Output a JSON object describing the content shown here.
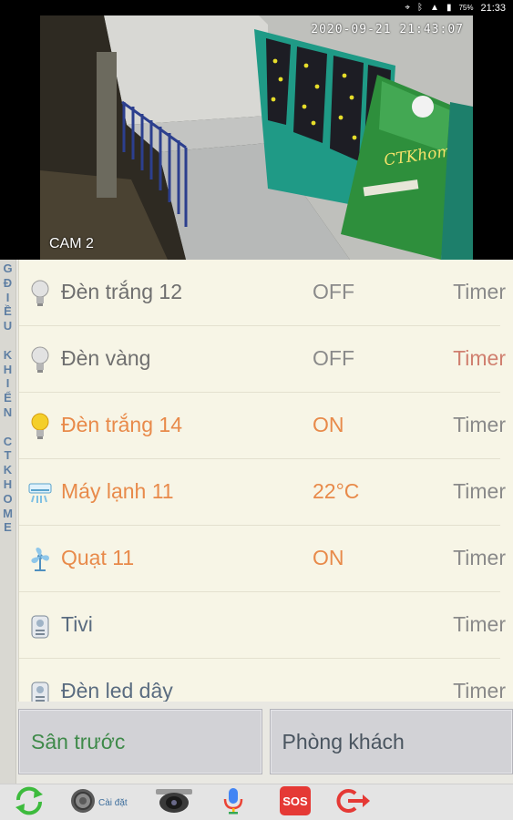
{
  "status_bar": {
    "battery": "75%",
    "time": "21:33"
  },
  "camera": {
    "timestamp": "2020-09-21 21:43:07",
    "label": "CAM 2",
    "sign_text": "CTKhome"
  },
  "side_strip": {
    "letters": [
      "G",
      "Đ",
      "I",
      "Ề",
      "U",
      "",
      "K",
      "H",
      "I",
      "Ể",
      "N",
      "",
      "C",
      "T",
      "K",
      "H",
      "O",
      "M",
      "E"
    ]
  },
  "devices": [
    {
      "name": "Đèn trắng 12",
      "state": "OFF",
      "timer": "Timer",
      "icon": "light-bulb-off-icon"
    },
    {
      "name": "Đèn vàng",
      "state": "OFF",
      "timer": "Timer",
      "icon": "light-bulb-off-icon"
    },
    {
      "name": "Đèn trắng 14",
      "state": "ON",
      "timer": "Timer",
      "icon": "light-bulb-on-icon"
    },
    {
      "name": "Máy lạnh 11",
      "state": "22°C",
      "timer": "Timer",
      "icon": "air-conditioner-icon"
    },
    {
      "name": "Quạt 11",
      "state": "ON",
      "timer": "Timer",
      "icon": "fan-icon"
    },
    {
      "name": "Tivi",
      "state": "",
      "timer": "Timer",
      "icon": "remote-control-icon"
    },
    {
      "name": "Đèn led dây",
      "state": "",
      "timer": "Timer",
      "icon": "remote-control-icon"
    }
  ],
  "rooms": {
    "left": "Sân trước",
    "right": "Phòng khách"
  },
  "toolbar": {
    "settings_label": "Cài đặt"
  },
  "colors": {
    "on": "#e88a4a",
    "off": "#8a8a8a",
    "active_room": "#3f8a4a",
    "strip_text": "#5f7fa3"
  }
}
